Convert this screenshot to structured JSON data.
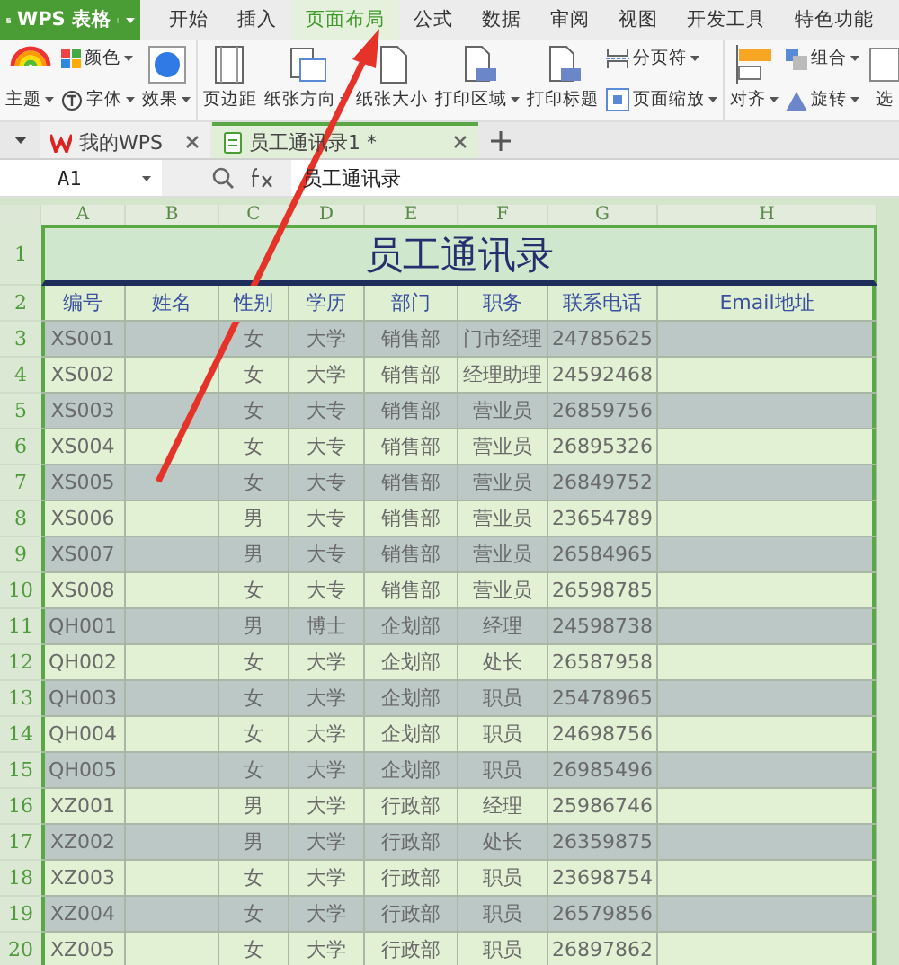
{
  "app_menu": {
    "label": "WPS 表格"
  },
  "menu_tabs": [
    {
      "label": "开始",
      "selected": false
    },
    {
      "label": "插入",
      "selected": false
    },
    {
      "label": "页面布局",
      "selected": true
    },
    {
      "label": "公式",
      "selected": false
    },
    {
      "label": "数据",
      "selected": false
    },
    {
      "label": "审阅",
      "selected": false
    },
    {
      "label": "视图",
      "selected": false
    },
    {
      "label": "开发工具",
      "selected": false
    },
    {
      "label": "特色功能",
      "selected": false
    }
  ],
  "ribbon": {
    "groups": [
      {
        "items": [
          {
            "kind": "large",
            "label": "主题",
            "dropdown": true
          },
          {
            "kind": "stack",
            "items": [
              {
                "label": "颜色",
                "dropdown": true
              },
              {
                "label": "字体",
                "dropdown": true
              }
            ]
          },
          {
            "kind": "large",
            "label": "效果",
            "dropdown": true
          }
        ]
      },
      {
        "items": [
          {
            "kind": "large",
            "label": "页边距",
            "dropdown": false
          },
          {
            "kind": "large",
            "label": "纸张方向",
            "dropdown": true
          },
          {
            "kind": "large",
            "label": "纸张大小",
            "dropdown": false
          },
          {
            "kind": "large",
            "label": "打印区域",
            "dropdown": true
          },
          {
            "kind": "large",
            "label": "打印标题",
            "dropdown": false
          },
          {
            "kind": "stack",
            "items": [
              {
                "label": "分页符",
                "dropdown": true
              },
              {
                "label": "页面缩放",
                "dropdown": true
              }
            ]
          }
        ]
      },
      {
        "items": [
          {
            "kind": "large",
            "label": "对齐",
            "dropdown": true
          },
          {
            "kind": "stack",
            "items": [
              {
                "label": "组合",
                "dropdown": true
              },
              {
                "label": "旋转",
                "dropdown": true
              }
            ]
          },
          {
            "kind": "large",
            "label": "选",
            "dropdown": false
          }
        ]
      }
    ]
  },
  "doc_tabs": [
    {
      "label": "我的WPS",
      "selected": false
    },
    {
      "label": "员工通讯录1 *",
      "selected": true
    }
  ],
  "formula_bar": {
    "cell_ref": "A1",
    "value": "员工通讯录"
  },
  "sheet": {
    "column_headers": [
      "A",
      "B",
      "C",
      "D",
      "E",
      "F",
      "G",
      "H"
    ],
    "title_row": {
      "row_number": "1",
      "title": "员工通讯录"
    },
    "header_row": {
      "row_number": "2",
      "cells": [
        "编号",
        "姓名",
        "性别",
        "学历",
        "部门",
        "职务",
        "联系电话",
        "Email地址"
      ]
    },
    "rows": [
      {
        "row_number": "3",
        "id": "XS001",
        "gender": "女",
        "education": "大学",
        "department": "销售部",
        "position": "门市经理",
        "phone": "24785625"
      },
      {
        "row_number": "4",
        "id": "XS002",
        "gender": "女",
        "education": "大学",
        "department": "销售部",
        "position": "经理助理",
        "phone": "24592468"
      },
      {
        "row_number": "5",
        "id": "XS003",
        "gender": "女",
        "education": "大专",
        "department": "销售部",
        "position": "营业员",
        "phone": "26859756"
      },
      {
        "row_number": "6",
        "id": "XS004",
        "gender": "女",
        "education": "大专",
        "department": "销售部",
        "position": "营业员",
        "phone": "26895326"
      },
      {
        "row_number": "7",
        "id": "XS005",
        "gender": "女",
        "education": "大专",
        "department": "销售部",
        "position": "营业员",
        "phone": "26849752"
      },
      {
        "row_number": "8",
        "id": "XS006",
        "gender": "男",
        "education": "大专",
        "department": "销售部",
        "position": "营业员",
        "phone": "23654789"
      },
      {
        "row_number": "9",
        "id": "XS007",
        "gender": "男",
        "education": "大专",
        "department": "销售部",
        "position": "营业员",
        "phone": "26584965"
      },
      {
        "row_number": "10",
        "id": "XS008",
        "gender": "女",
        "education": "大专",
        "department": "销售部",
        "position": "营业员",
        "phone": "26598785"
      },
      {
        "row_number": "11",
        "id": "QH001",
        "gender": "男",
        "education": "博士",
        "department": "企划部",
        "position": "经理",
        "phone": "24598738"
      },
      {
        "row_number": "12",
        "id": "QH002",
        "gender": "女",
        "education": "大学",
        "department": "企划部",
        "position": "处长",
        "phone": "26587958"
      },
      {
        "row_number": "13",
        "id": "QH003",
        "gender": "女",
        "education": "大学",
        "department": "企划部",
        "position": "职员",
        "phone": "25478965"
      },
      {
        "row_number": "14",
        "id": "QH004",
        "gender": "女",
        "education": "大学",
        "department": "企划部",
        "position": "职员",
        "phone": "24698756"
      },
      {
        "row_number": "15",
        "id": "QH005",
        "gender": "女",
        "education": "大学",
        "department": "企划部",
        "position": "职员",
        "phone": "26985496"
      },
      {
        "row_number": "16",
        "id": "XZ001",
        "gender": "男",
        "education": "大学",
        "department": "行政部",
        "position": "经理",
        "phone": "25986746"
      },
      {
        "row_number": "17",
        "id": "XZ002",
        "gender": "男",
        "education": "大学",
        "department": "行政部",
        "position": "处长",
        "phone": "26359875"
      },
      {
        "row_number": "18",
        "id": "XZ003",
        "gender": "女",
        "education": "大学",
        "department": "行政部",
        "position": "职员",
        "phone": "23698754"
      },
      {
        "row_number": "19",
        "id": "XZ004",
        "gender": "女",
        "education": "大学",
        "department": "行政部",
        "position": "职员",
        "phone": "26579856"
      },
      {
        "row_number": "20",
        "id": "XZ005",
        "gender": "女",
        "education": "大学",
        "department": "行政部",
        "position": "职员",
        "phone": "26897862"
      }
    ]
  }
}
